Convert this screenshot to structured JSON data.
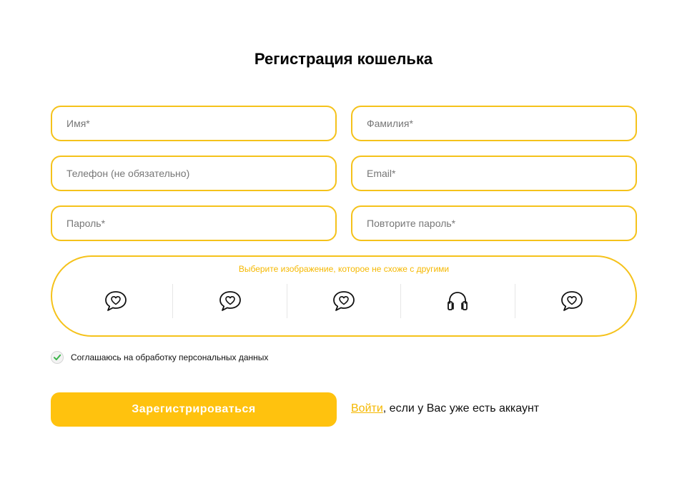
{
  "title": "Регистрация кошелька",
  "fields": {
    "first_name": {
      "value": "",
      "placeholder": "Имя*"
    },
    "last_name": {
      "value": "",
      "placeholder": "Фамилия*"
    },
    "phone": {
      "value": "",
      "placeholder": "Телефон (не обязательно)"
    },
    "email": {
      "value": "",
      "placeholder": "Email*"
    },
    "password": {
      "value": "",
      "placeholder": "Пароль*"
    },
    "password_repeat": {
      "value": "",
      "placeholder": "Повторите пароль*"
    }
  },
  "captcha": {
    "label": "Выберите изображение, которое не схоже с другими",
    "options": [
      "heart-speech-bubble-icon",
      "heart-speech-bubble-icon",
      "heart-speech-bubble-icon",
      "headphones-icon",
      "heart-speech-bubble-icon"
    ]
  },
  "consent": {
    "label": "Соглашаюсь на обработку персональных данных",
    "checked": true
  },
  "submit_label": "Зарегистрироваться",
  "login": {
    "link_text": "Войти",
    "rest_text": ", если у Вас уже есть аккаунт"
  },
  "colors": {
    "accent": "#ffc20e",
    "border": "#f5c21b",
    "check": "#3bb54a"
  }
}
